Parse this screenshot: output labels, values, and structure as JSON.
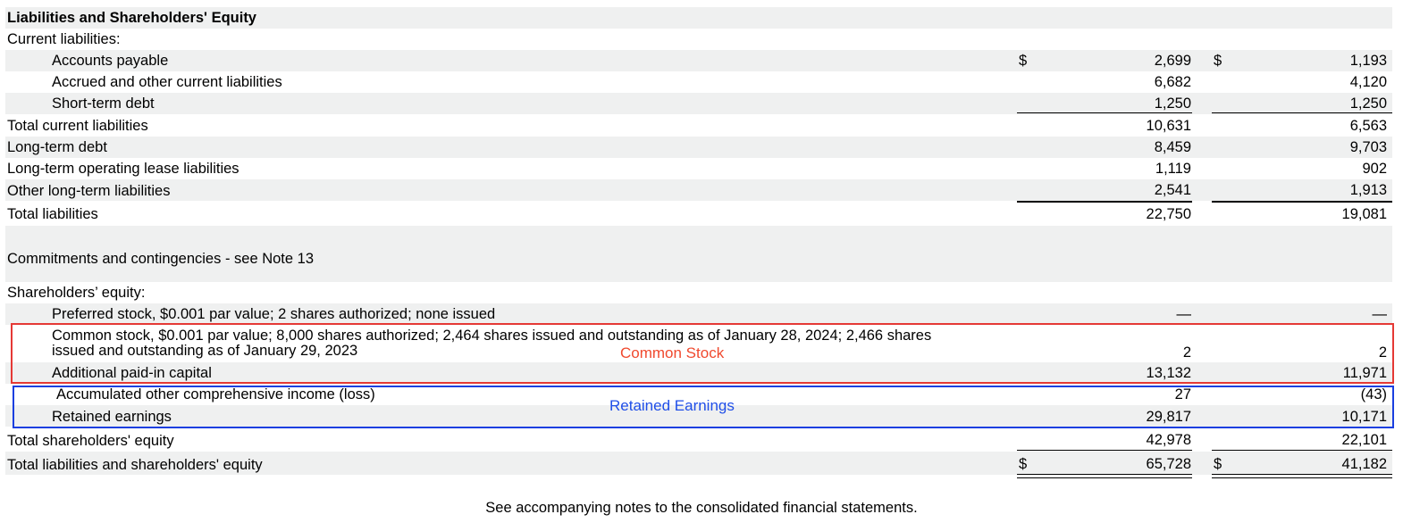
{
  "heading": "Liabilities and Shareholders' Equity",
  "current_liabilities_label": "Current liabilities:",
  "currency_symbol": "$",
  "rows": {
    "accounts_payable": {
      "label": "Accounts payable",
      "v2024": "2,699",
      "v2023": "1,193"
    },
    "accrued": {
      "label": "Accrued and other current liabilities",
      "v2024": "6,682",
      "v2023": "4,120"
    },
    "short_term_debt": {
      "label": "Short-term debt",
      "v2024": "1,250",
      "v2023": "1,250"
    },
    "total_current": {
      "label": "Total current liabilities",
      "v2024": "10,631",
      "v2023": "6,563"
    },
    "long_term_debt": {
      "label": "Long-term debt",
      "v2024": "8,459",
      "v2023": "9,703"
    },
    "lease": {
      "label": "Long-term operating lease liabilities",
      "v2024": "1,119",
      "v2023": "902"
    },
    "other_lt": {
      "label": "Other long-term liabilities",
      "v2024": "2,541",
      "v2023": "1,913"
    },
    "total_liabilities": {
      "label": "Total liabilities",
      "v2024": "22,750",
      "v2023": "19,081"
    },
    "commitments": {
      "label": "Commitments and contingencies - see Note 13"
    },
    "equity_heading": {
      "label": "Shareholders’ equity:"
    },
    "preferred": {
      "label": "Preferred stock, $0.001 par value; 2 shares authorized; none issued",
      "v2024": "—",
      "v2023": "—"
    },
    "common_line1": {
      "label": "Common stock, $0.001 par value; 8,000 shares authorized; 2,464 shares issued and outstanding as of January 28, 2024; 2,466 shares"
    },
    "common_line2": {
      "label": "issued and outstanding as of January 29, 2023",
      "v2024": "2",
      "v2023": "2"
    },
    "apic": {
      "label": "Additional paid-in capital",
      "v2024": "13,132",
      "v2023": "11,971"
    },
    "aoci": {
      "label": "Accumulated other comprehensive income (loss)",
      "v2024": "27",
      "v2023": "(43)"
    },
    "retained": {
      "label": "Retained earnings",
      "v2024": "29,817",
      "v2023": "10,171"
    },
    "total_equity": {
      "label": "Total shareholders' equity",
      "v2024": "42,978",
      "v2023": "22,101"
    },
    "total_le": {
      "label": "Total liabilities and shareholders' equity",
      "v2024": "65,728",
      "v2023": "41,182"
    }
  },
  "annotations": {
    "common_stock": "Common Stock",
    "retained_earnings": "Retained Earnings"
  },
  "colors": {
    "row_shade": "#eff0f0",
    "annotation_red": "#e53935",
    "annotation_blue": "#1a3fe0"
  },
  "footer_note": "See accompanying notes to the consolidated financial statements."
}
